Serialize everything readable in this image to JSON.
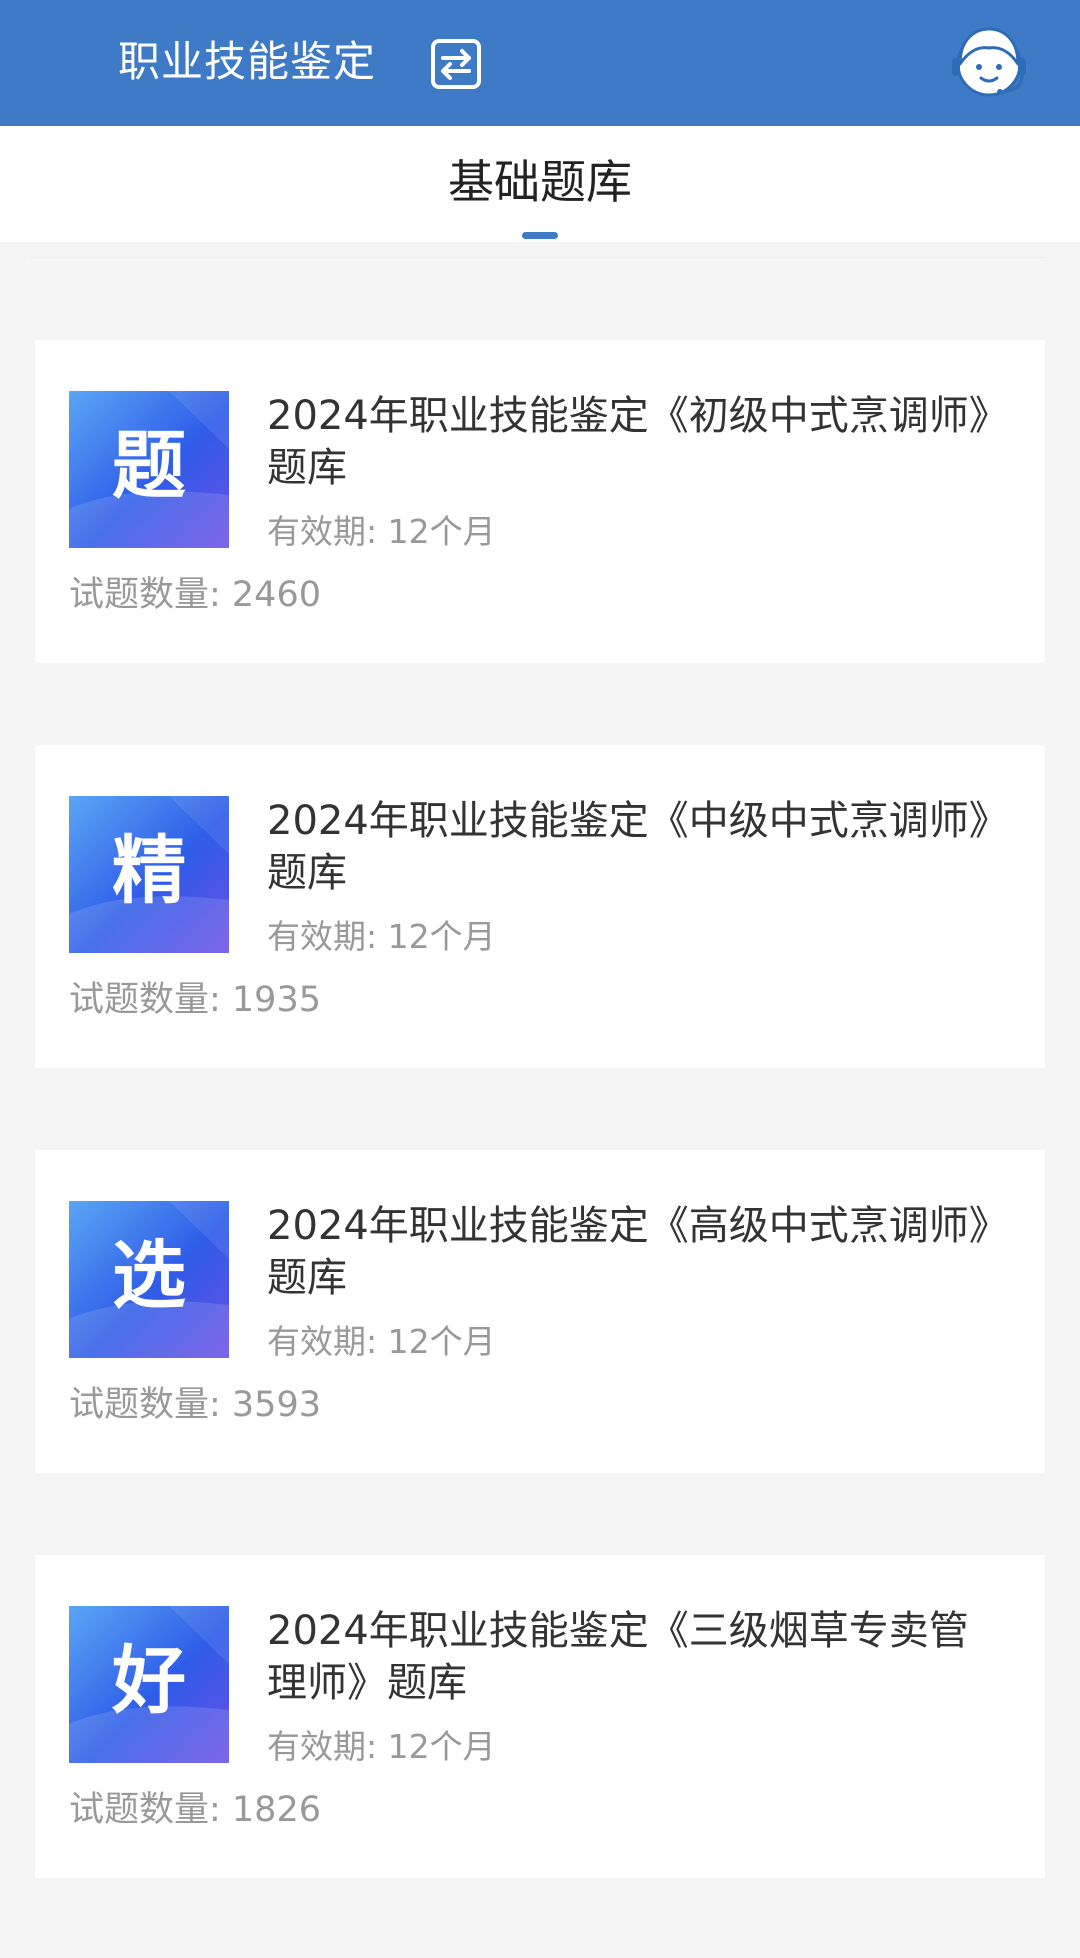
{
  "header": {
    "title": "职业技能鉴定",
    "switch_icon": "switch-icon",
    "service_icon": "customer-service-icon",
    "background_color": "#3f7ac6"
  },
  "tabs": [
    {
      "label": "基础题库",
      "active": true
    }
  ],
  "cards": [
    {
      "badge": "题",
      "title": "2024年职业技能鉴定《初级中式烹调师》题库",
      "validity": "有效期: 12个月",
      "count": "试题数量: 2460"
    },
    {
      "badge": "精",
      "title": "2024年职业技能鉴定《中级中式烹调师》题库",
      "validity": "有效期: 12个月",
      "count": "试题数量: 1935"
    },
    {
      "badge": "选",
      "title": "2024年职业技能鉴定《高级中式烹调师》题库",
      "validity": "有效期: 12个月",
      "count": "试题数量: 3593"
    },
    {
      "badge": "好",
      "title": "2024年职业技能鉴定《三级烟草专卖管理师》题库",
      "validity": "有效期: 12个月",
      "count": "试题数量: 1826"
    }
  ]
}
